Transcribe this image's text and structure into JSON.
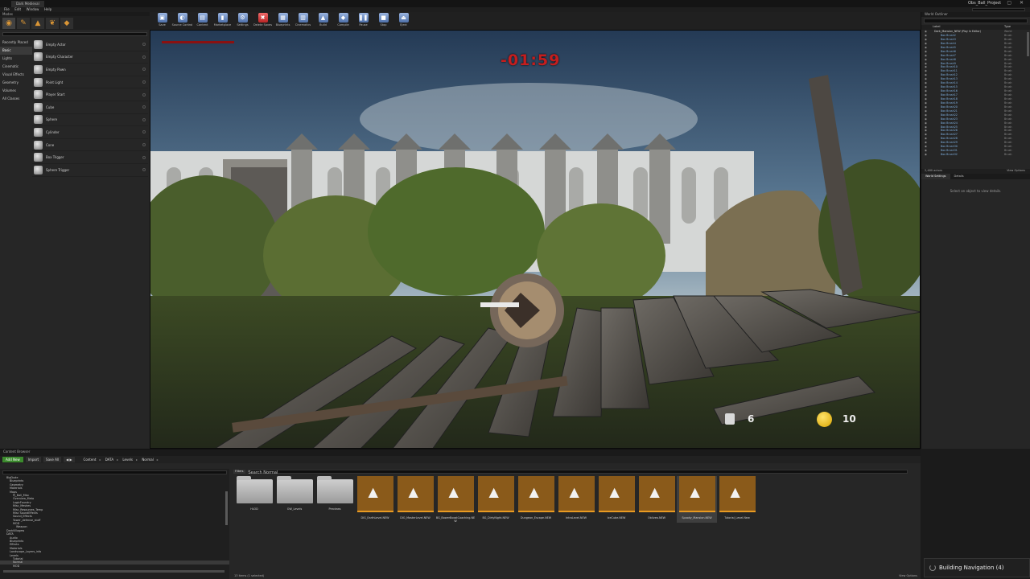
{
  "window": {
    "tab_title": "Dark Medieval",
    "project_name": "Obs_Ball_Project",
    "controls": "‒ ▢ ✕"
  },
  "menubar": {
    "items": [
      "File",
      "Edit",
      "Window",
      "Help"
    ]
  },
  "modes": {
    "title": "Modes",
    "categories": [
      "Recently Placed",
      "Basic",
      "Lights",
      "Cinematic",
      "Visual Effects",
      "Geometry",
      "Volumes",
      "All Classes"
    ],
    "items": [
      "Empty Actor",
      "Empty Character",
      "Empty Pawn",
      "Point Light",
      "Player Start",
      "Cube",
      "Sphere",
      "Cylinder",
      "Cone",
      "Box Trigger",
      "Sphere Trigger"
    ]
  },
  "toolbar": {
    "buttons": [
      {
        "label": "Save",
        "icon": "save-icon",
        "glyph": "▣"
      },
      {
        "label": "Source Control",
        "icon": "source-control-icon",
        "glyph": "◐"
      },
      {
        "label": "Content",
        "icon": "content-icon",
        "glyph": "▤"
      },
      {
        "label": "Marketplace",
        "icon": "marketplace-icon",
        "glyph": "▮"
      },
      {
        "label": "Settings",
        "icon": "settings-icon",
        "glyph": "⚙"
      },
      {
        "label": "Delete Saves",
        "icon": "delete-saves-icon",
        "glyph": "✖"
      },
      {
        "label": "Blueprints",
        "icon": "blueprints-icon",
        "glyph": "▦"
      },
      {
        "label": "Cinematics",
        "icon": "cinematics-icon",
        "glyph": "▥"
      },
      {
        "label": "Build",
        "icon": "build-icon",
        "glyph": "▲"
      },
      {
        "label": "Compile",
        "icon": "compile-icon",
        "glyph": "◆"
      },
      {
        "label": "Pause",
        "icon": "pause-icon",
        "glyph": "❚❚"
      },
      {
        "label": "Stop",
        "icon": "stop-icon",
        "glyph": "■"
      },
      {
        "label": "Eject",
        "icon": "eject-icon",
        "glyph": "⏏"
      }
    ]
  },
  "viewport": {
    "timer": "-01:59",
    "ammo": "6",
    "coins": "10",
    "colors": {
      "timer": "#c41e1e",
      "coin": "#e2b310"
    }
  },
  "outliner": {
    "title": "World Outliner",
    "col_label": "Label",
    "col_type": "Type",
    "root": "Dark_Mansion_NEW (Play In Editor)",
    "root_type": "World",
    "actors": [
      "Box Brush2",
      "Box Brush3",
      "Box Brush4",
      "Box Brush5",
      "Box Brush6",
      "Box Brush7",
      "Box Brush8",
      "Box Brush9",
      "Box Brush10",
      "Box Brush11",
      "Box Brush12",
      "Box Brush13",
      "Box Brush14",
      "Box Brush15",
      "Box Brush16",
      "Box Brush17",
      "Box Brush18",
      "Box Brush19",
      "Box Brush20",
      "Box Brush21",
      "Box Brush22",
      "Box Brush23",
      "Box Brush24",
      "Box Brush25",
      "Box Brush26",
      "Box Brush27",
      "Box Brush28",
      "Box Brush29",
      "Box Brush30",
      "Box Brush31",
      "Box Brush32"
    ],
    "actor_type": "Brush",
    "count": "2,480 actors",
    "view_options": "View Options"
  },
  "details": {
    "tabs": [
      "World Settings",
      "Details"
    ],
    "message": "Select an object to view details."
  },
  "content_browser": {
    "title": "Content Browser",
    "add_new": "Add New",
    "import": "Import",
    "save_all": "Save All",
    "breadcrumb": [
      "Content",
      "DATA",
      "Levels",
      "Normal"
    ],
    "filters": "Filters",
    "search_placeholder": "Search Normal",
    "tree": [
      "BigDude",
      "Blueprints",
      "Geometry",
      "Materials",
      "Maps",
      "PJ_Ball_Misc",
      "Overview_Meta",
      "LogicFoundry",
      "Misc_Meshes",
      "Misc_Resources_Temp",
      "Misc SoundEffects",
      "Sound_Effects",
      "Tower_defense_stuff",
      "MOD",
      "Weapon",
      "DarkVillagew",
      "DATA",
      "Audio",
      "Blueprints",
      "Effects",
      "Materials",
      "Landscape_Layers_info",
      "Levels",
      "Tutorial",
      "Normal",
      "MOD"
    ],
    "assets": [
      {
        "name": "HLOD",
        "kind": "folder"
      },
      {
        "name": "OW_Levels",
        "kind": "folder"
      },
      {
        "name": "Previews",
        "kind": "folder"
      },
      {
        "name": "DIG_EarthLevel.NEW",
        "kind": "map"
      },
      {
        "name": "DIG_MasterLevel.NEW",
        "kind": "map"
      },
      {
        "name": "BG_BowerBoostCoaching.NEW",
        "kind": "map"
      },
      {
        "name": "BG_DirtyNight.NEW",
        "kind": "map"
      },
      {
        "name": "Dungeon_Escape.NEW",
        "kind": "map"
      },
      {
        "name": "IntroLevel.NEW",
        "kind": "map"
      },
      {
        "name": "IceCube.NEW",
        "kind": "map"
      },
      {
        "name": "Oblivea.NEW",
        "kind": "map"
      },
      {
        "name": "Spooky_Mansion.NEW",
        "kind": "map",
        "selected": true
      },
      {
        "name": "Tutorial_Level.New",
        "kind": "map"
      }
    ],
    "count": "13 items (1 selected)",
    "view_options": "View Options"
  },
  "toast": {
    "text": "Building Navigation (4)"
  }
}
